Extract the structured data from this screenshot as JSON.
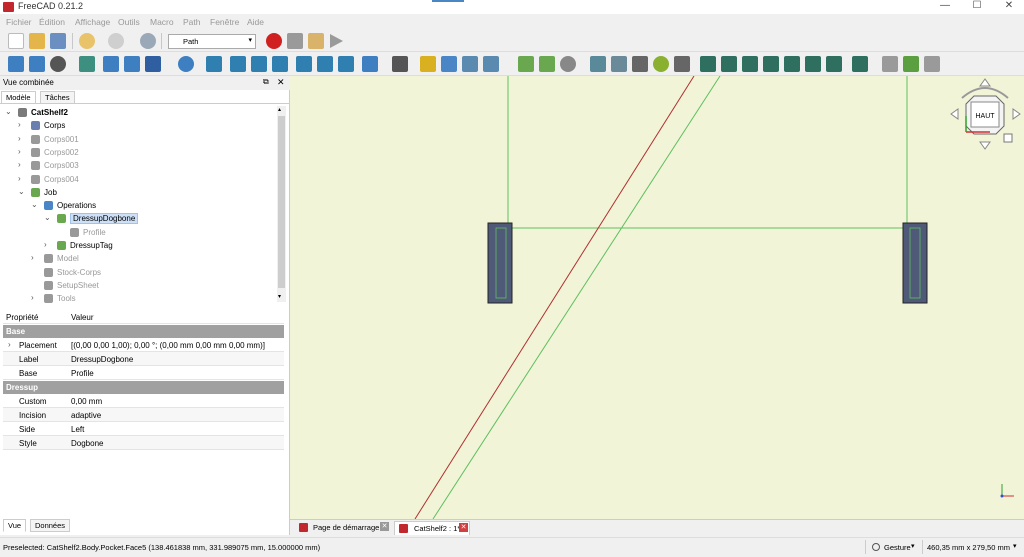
{
  "app": {
    "title": "FreeCAD 0.21.2"
  },
  "window_controls": {
    "minimize": "—",
    "maximize": "☐",
    "close": "✕"
  },
  "menu": [
    "Fichier",
    "Édition",
    "Affichage",
    "Outils",
    "Macro",
    "Path",
    "Fenêtre",
    "Aide"
  ],
  "toolbar": {
    "workbench": "Path"
  },
  "panel": {
    "title": "Vue combinée",
    "tabs": [
      "Modèle",
      "Tâches"
    ],
    "bottom_tabs": [
      "Vue",
      "Données"
    ]
  },
  "tree": [
    {
      "label": "CatShelf2",
      "bold": true,
      "icon": "document-icon",
      "color": "#7a7a7a"
    },
    {
      "label": "Corps",
      "icon": "body-icon",
      "color": "#6a7fb0"
    },
    {
      "label": "Corps001",
      "icon": "body-icon",
      "color": "#999999",
      "grey": true
    },
    {
      "label": "Corps002",
      "icon": "body-icon",
      "color": "#999999",
      "grey": true
    },
    {
      "label": "Corps003",
      "icon": "body-icon",
      "color": "#999999",
      "grey": true
    },
    {
      "label": "Corps004",
      "icon": "body-icon",
      "color": "#999999",
      "grey": true
    },
    {
      "label": "Job",
      "icon": "job-icon",
      "color": "#6aa84f"
    },
    {
      "label": "Operations",
      "icon": "folder-icon",
      "color": "#4a86c5"
    },
    {
      "label": "DressupDogbone",
      "icon": "dogbone-icon",
      "color": "#6aa84f",
      "selected": true
    },
    {
      "label": "Profile",
      "icon": "profile-icon",
      "color": "#999999",
      "grey": true
    },
    {
      "label": "DressupTag",
      "icon": "tag-icon",
      "color": "#6aa84f"
    },
    {
      "label": "Model",
      "icon": "folder-icon",
      "color": "#999999",
      "grey": true
    },
    {
      "label": "Stock-Corps",
      "icon": "stock-icon",
      "color": "#999999",
      "grey": true
    },
    {
      "label": "SetupSheet",
      "icon": "sheet-icon",
      "color": "#999999",
      "grey": true
    },
    {
      "label": "Tools",
      "icon": "folder-icon",
      "color": "#999999",
      "grey": true
    }
  ],
  "properties": {
    "header": {
      "name": "Propriété",
      "value": "Valeur"
    },
    "groups": [
      {
        "name": "Base",
        "rows": [
          {
            "key": "Placement",
            "value": "[(0,00 0,00 1,00); 0,00 °; (0,00 mm  0,00 mm  0,00 mm)]"
          },
          {
            "key": "Label",
            "value": "DressupDogbone"
          },
          {
            "key": "Base",
            "value": "Profile"
          }
        ]
      },
      {
        "name": "Dressup",
        "rows": [
          {
            "key": "Custom",
            "value": "0,00 mm"
          },
          {
            "key": "Incision",
            "value": "adaptive"
          },
          {
            "key": "Side",
            "value": "Left"
          },
          {
            "key": "Style",
            "value": "Dogbone"
          }
        ]
      }
    ]
  },
  "navcube": {
    "face": "HAUT"
  },
  "doc_tabs": [
    "Page de démarrage",
    "CatShelf2 : 1*"
  ],
  "status": {
    "message": "Preselected: CatShelf2.Body.Pocket.Face5 (138.461838 mm, 331.989075 mm, 15.000000 mm)",
    "nav_style": "Gesture",
    "dimensions": "460,35 mm x 279,50 mm"
  },
  "colors": {
    "viewport_bg": "#f2f4d8",
    "path_green": "#5fbf5f",
    "path_red": "#b03030",
    "part_fill": "#4f5a78",
    "selection": "#cde0f7"
  }
}
